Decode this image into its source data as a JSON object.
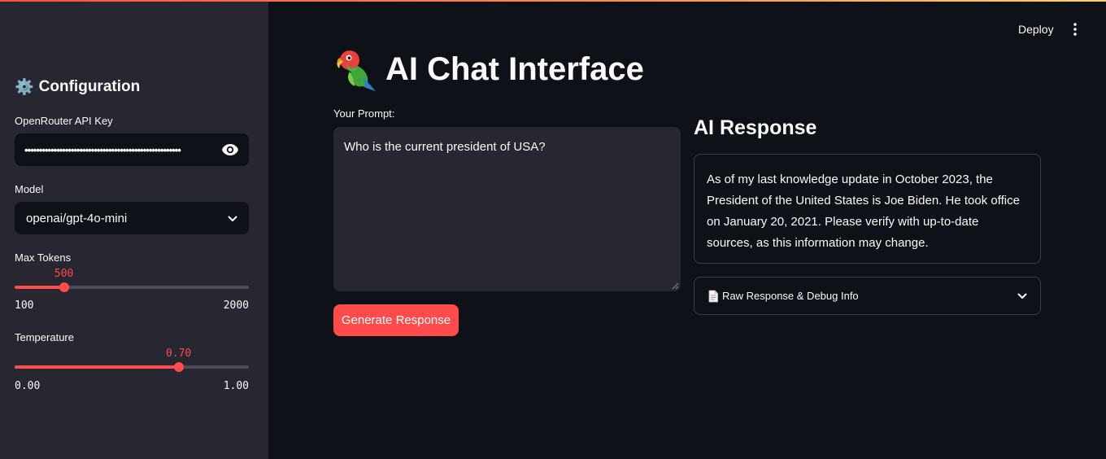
{
  "sidebar": {
    "heading_icon": "⚙️",
    "heading": "Configuration",
    "api_key": {
      "label": "OpenRouter API Key",
      "masked_value": "••••••••••••••••••••••••••••••••••••••••••••••••••••••"
    },
    "model": {
      "label": "Model",
      "value": "openai/gpt-4o-mini"
    },
    "max_tokens": {
      "label": "Max Tokens",
      "value": "500",
      "min": "100",
      "max": "2000",
      "fraction": 0.2105
    },
    "temperature": {
      "label": "Temperature",
      "value": "0.70",
      "min": "0.00",
      "max": "1.00",
      "fraction": 0.7
    }
  },
  "header": {
    "deploy_label": "Deploy"
  },
  "main": {
    "title": "AI Chat Interface",
    "prompt_label": "Your Prompt:",
    "prompt_value": "Who is the current president of USA?",
    "generate_label": "Generate Response",
    "response_heading": "AI Response",
    "response_text": "As of my last knowledge update in October 2023, the President of the United States is Joe Biden. He took office on January 20, 2021. Please verify with up-to-date sources, as this information may change.",
    "expander_label": "Raw Response & Debug Info"
  },
  "colors": {
    "accent": "#ff4b4b",
    "background": "#0e1117",
    "sidebar": "#262730"
  }
}
